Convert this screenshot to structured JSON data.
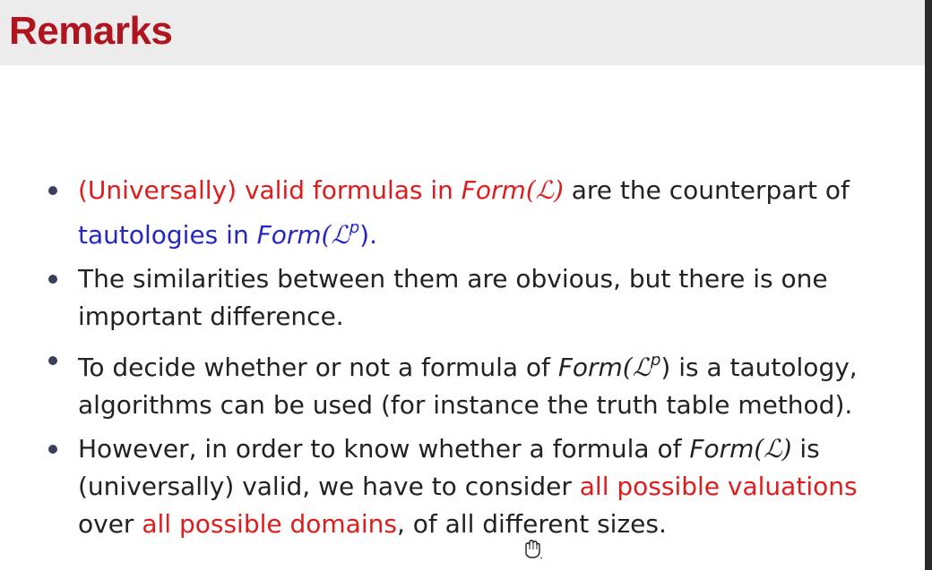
{
  "slide": {
    "title": "Remarks",
    "bullets": [
      {
        "lines": [
          "(Universally) valid formulas in Form(ℒ) are the counterpart of",
          "tautologies in Form(ℒ^p)."
        ]
      },
      {
        "lines": [
          "The similarities between them are obvious, but there is one",
          "important difference."
        ]
      },
      {
        "lines": [
          "To decide whether or not a formula of Form(ℒ^p) is a tautology,",
          "algorithms can be used (for instance the truth table method)."
        ]
      },
      {
        "lines": [
          "However, in order to know whether a formula of Form(ℒ) is",
          "(universally) valid, we have to consider all possible valuations",
          "over all possible domains, of all different sizes."
        ]
      }
    ],
    "segments": {
      "b1_red": "(Universally) valid formulas in ",
      "b1_form": "Form",
      "b1_L": "(ℒ)",
      "b1_rest": " are the counterpart of",
      "b1_blue": "tautologies in ",
      "b1_form2": "Form",
      "b1_L2": "(ℒ",
      "b1_p": "p",
      "b1_close": ").",
      "b2_text": "The similarities between them are obvious, but there is one important difference.",
      "b3_a": "To decide whether or not a formula of ",
      "b3_form": "Form",
      "b3_L": "(ℒ",
      "b3_p": "p",
      "b3_close": ")",
      "b3_b": " is a tautology, algorithms can be used (for instance the truth table method).",
      "b4_a": "However, in order to know whether a formula of ",
      "b4_form": "Form",
      "b4_L": "(ℒ)",
      "b4_b": " is (universally) valid, we have to consider ",
      "b4_red1": "all possible valuations",
      "b4_c": " over ",
      "b4_red2": "all possible domains",
      "b4_d": ", of all different sizes."
    },
    "colors": {
      "title": "#b0141e",
      "highlight_red": "#e01b1b",
      "highlight_blue": "#2626c8",
      "bullet_dot": "#3a3f5c"
    },
    "cursor_icon": "hand-cursor-icon"
  }
}
